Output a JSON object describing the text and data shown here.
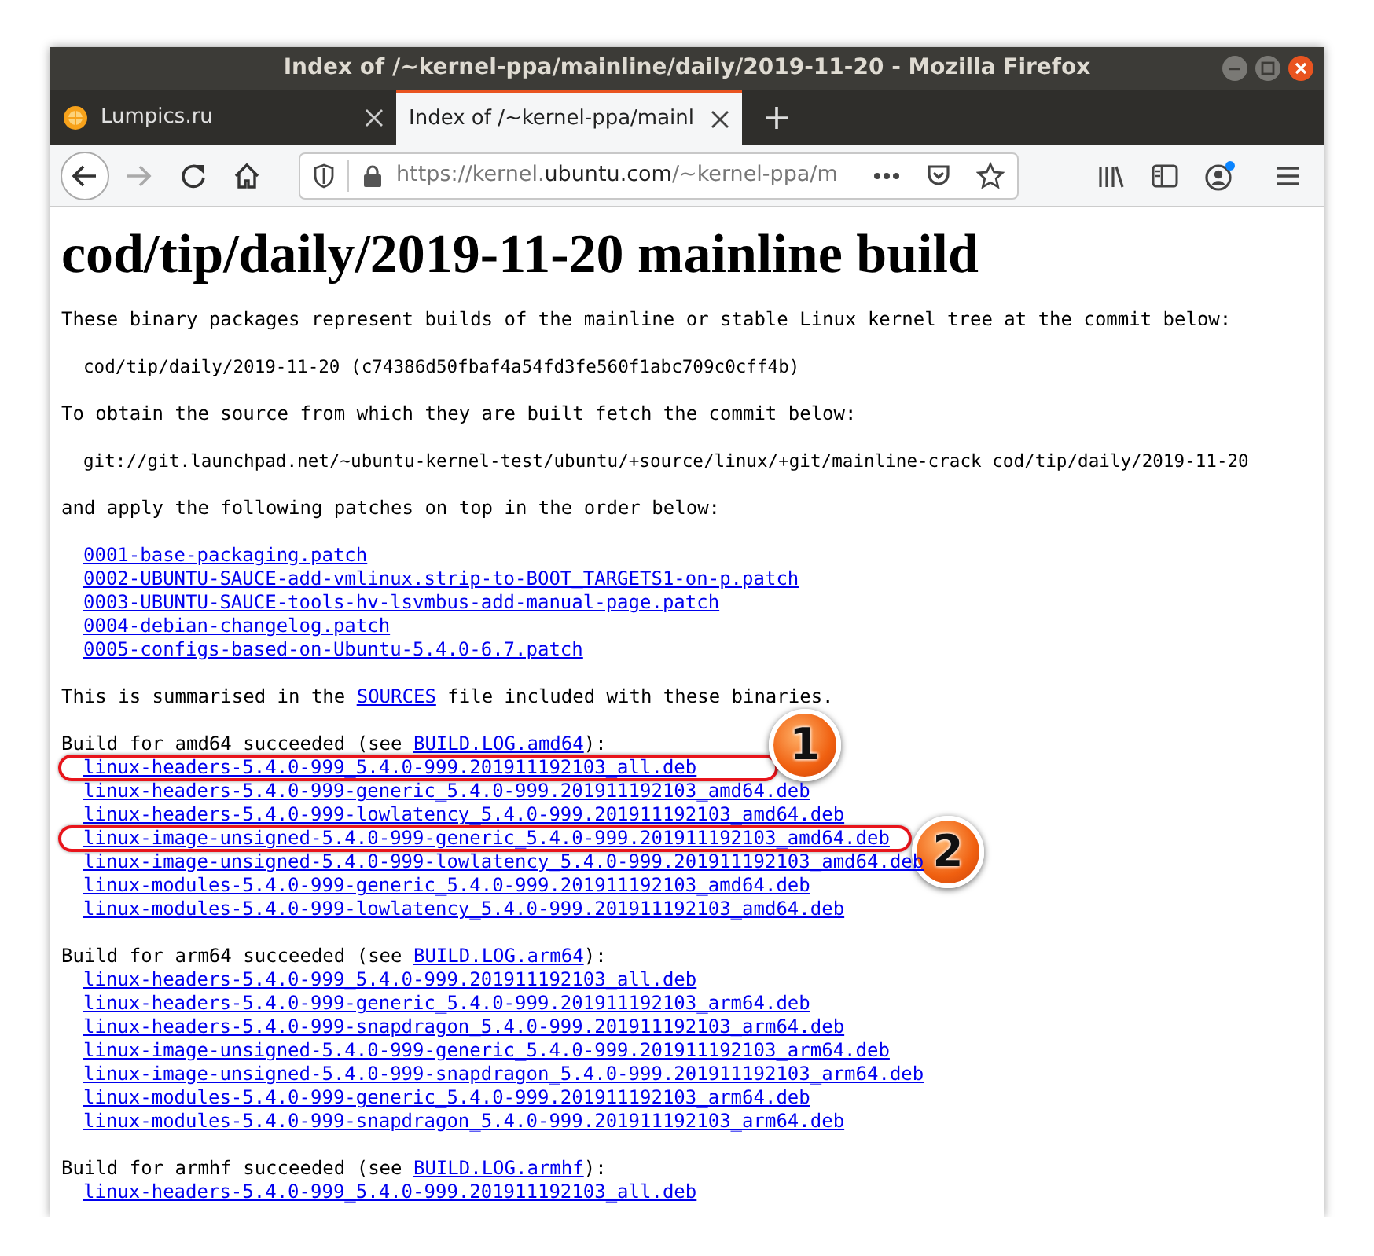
{
  "window": {
    "title": "Index of /~kernel-ppa/mainline/daily/2019-11-20 - Mozilla Firefox"
  },
  "tabs": [
    {
      "label": "Lumpics.ru",
      "selected": false
    },
    {
      "label": "Index of /~kernel-ppa/mainl",
      "selected": true
    }
  ],
  "address_bar": {
    "url_prefix": "https://kernel.",
    "url_domain": "ubuntu.com",
    "url_path": "/~kernel-ppa/m"
  },
  "page": {
    "heading": "cod/tip/daily/2019-11-20 mainline build",
    "blocks": [
      {
        "kind": "para",
        "segments": [
          {
            "text": "These binary packages represent builds of the mainline or stable Linux kernel tree at the commit below:",
            "link": false
          }
        ]
      },
      {
        "kind": "pre",
        "text": "cod/tip/daily/2019-11-20 (c74386d50fbaf4a54fd3fe560f1abc709c0cff4b)"
      },
      {
        "kind": "para",
        "segments": [
          {
            "text": "To obtain the source from which they are built fetch the commit below:",
            "link": false
          }
        ]
      },
      {
        "kind": "pre",
        "text": "git://git.launchpad.net/~ubuntu-kernel-test/ubuntu/+source/linux/+git/mainline-crack cod/tip/daily/2019-11-20"
      },
      {
        "kind": "para",
        "segments": [
          {
            "text": "and apply the following patches on top in the order below:",
            "link": false
          }
        ]
      },
      {
        "kind": "links",
        "items": [
          {
            "text": "0001-base-packaging.patch"
          },
          {
            "text": "0002-UBUNTU-SAUCE-add-vmlinux.strip-to-BOOT_TARGETS1-on-p.patch"
          },
          {
            "text": "0003-UBUNTU-SAUCE-tools-hv-lsvmbus-add-manual-page.patch"
          },
          {
            "text": "0004-debian-changelog.patch"
          },
          {
            "text": "0005-configs-based-on-Ubuntu-5.4.0-6.7.patch"
          }
        ]
      },
      {
        "kind": "para",
        "segments": [
          {
            "text": "This is summarised in the ",
            "link": false
          },
          {
            "text": "SOURCES",
            "link": true
          },
          {
            "text": " file included with these binaries.",
            "link": false
          }
        ]
      },
      {
        "kind": "build",
        "segments": [
          {
            "text": "Build for amd64 succeeded (see ",
            "link": false
          },
          {
            "text": "BUILD.LOG.amd64",
            "link": true
          },
          {
            "text": "):",
            "link": false
          }
        ],
        "items": [
          {
            "text": "linux-headers-5.4.0-999_5.4.0-999.201911192103_all.deb",
            "callout": "1"
          },
          {
            "text": "linux-headers-5.4.0-999-generic_5.4.0-999.201911192103_amd64.deb"
          },
          {
            "text": "linux-headers-5.4.0-999-lowlatency_5.4.0-999.201911192103_amd64.deb"
          },
          {
            "text": "linux-image-unsigned-5.4.0-999-generic_5.4.0-999.201911192103_amd64.deb",
            "callout": "2"
          },
          {
            "text": "linux-image-unsigned-5.4.0-999-lowlatency_5.4.0-999.201911192103_amd64.deb"
          },
          {
            "text": "linux-modules-5.4.0-999-generic_5.4.0-999.201911192103_amd64.deb"
          },
          {
            "text": "linux-modules-5.4.0-999-lowlatency_5.4.0-999.201911192103_amd64.deb"
          }
        ]
      },
      {
        "kind": "build",
        "segments": [
          {
            "text": "Build for arm64 succeeded (see ",
            "link": false
          },
          {
            "text": "BUILD.LOG.arm64",
            "link": true
          },
          {
            "text": "):",
            "link": false
          }
        ],
        "items": [
          {
            "text": "linux-headers-5.4.0-999_5.4.0-999.201911192103_all.deb"
          },
          {
            "text": "linux-headers-5.4.0-999-generic_5.4.0-999.201911192103_arm64.deb"
          },
          {
            "text": "linux-headers-5.4.0-999-snapdragon_5.4.0-999.201911192103_arm64.deb"
          },
          {
            "text": "linux-image-unsigned-5.4.0-999-generic_5.4.0-999.201911192103_arm64.deb"
          },
          {
            "text": "linux-image-unsigned-5.4.0-999-snapdragon_5.4.0-999.201911192103_arm64.deb"
          },
          {
            "text": "linux-modules-5.4.0-999-generic_5.4.0-999.201911192103_arm64.deb"
          },
          {
            "text": "linux-modules-5.4.0-999-snapdragon_5.4.0-999.201911192103_arm64.deb"
          }
        ]
      },
      {
        "kind": "build",
        "segments": [
          {
            "text": "Build for armhf succeeded (see ",
            "link": false
          },
          {
            "text": "BUILD.LOG.armhf",
            "link": true
          },
          {
            "text": "):",
            "link": false
          }
        ],
        "items": [
          {
            "text": "linux-headers-5.4.0-999_5.4.0-999.201911192103_all.deb"
          }
        ]
      }
    ]
  }
}
